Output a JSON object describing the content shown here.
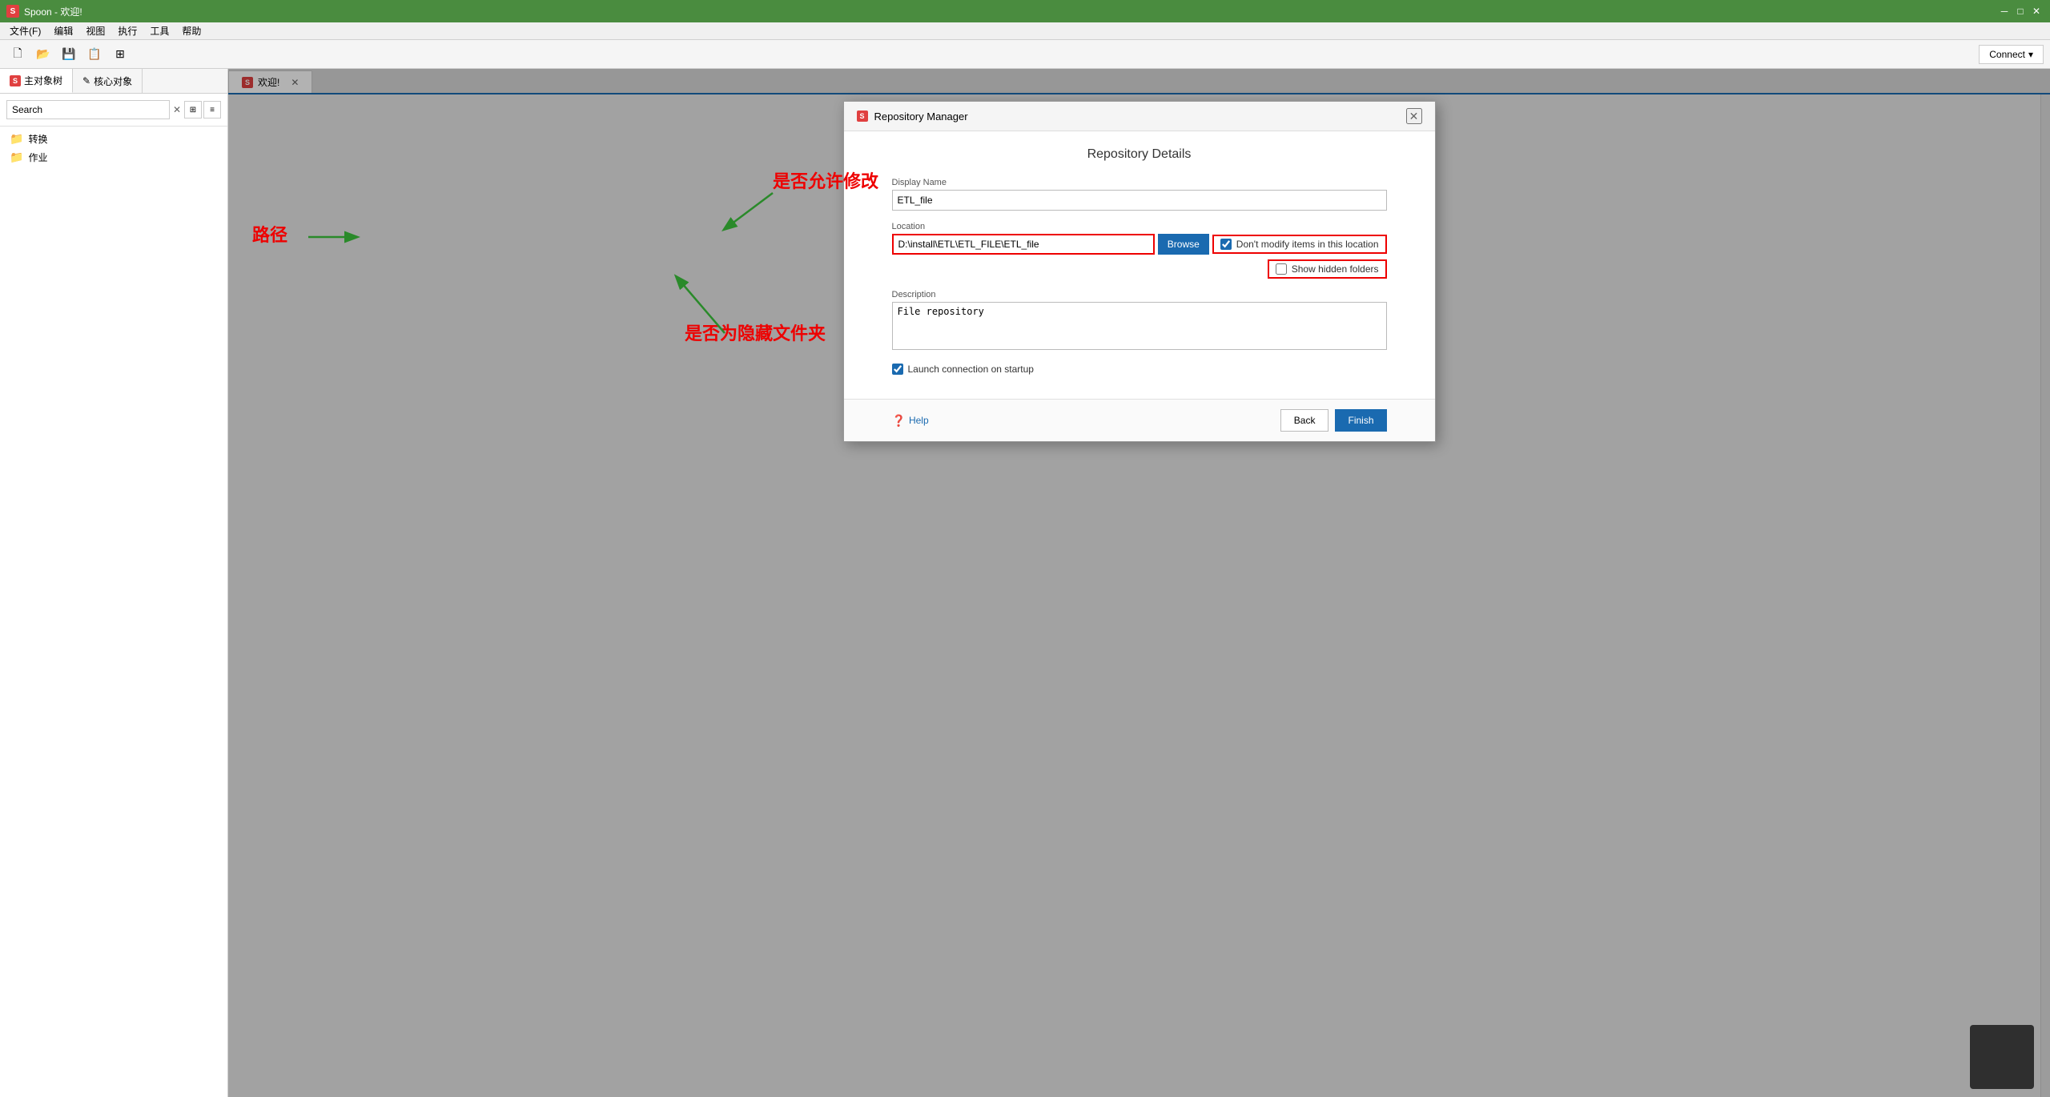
{
  "titleBar": {
    "title": "Spoon - 欢迎!",
    "iconLabel": "S",
    "minimizeBtn": "─",
    "maximizeBtn": "□",
    "closeBtn": "✕"
  },
  "menuBar": {
    "items": [
      "文件(F)",
      "编辑",
      "视图",
      "执行",
      "工具",
      "帮助"
    ]
  },
  "toolbar": {
    "connectBtn": "Connect",
    "connectArrow": "▾"
  },
  "leftPanel": {
    "tabs": [
      {
        "label": "主对象树",
        "iconLabel": "S"
      },
      {
        "label": "核心对象",
        "iconLabel": "✎"
      }
    ],
    "search": {
      "placeholder": "Search",
      "value": "Search"
    },
    "treeItems": [
      {
        "label": "转换"
      },
      {
        "label": "作业"
      }
    ]
  },
  "contentArea": {
    "tabs": [
      {
        "label": "欢迎!",
        "iconLabel": "S",
        "active": true
      }
    ]
  },
  "modal": {
    "titleBar": {
      "iconLabel": "S",
      "title": "Repository Manager",
      "closeBtn": "✕"
    },
    "heading": "Repository Details",
    "form": {
      "displayNameLabel": "Display Name",
      "displayNameValue": "ETL_file",
      "locationLabel": "Location",
      "locationValue": "D:\\install\\ETL\\ETL_FILE\\ETL_file",
      "browseBtnLabel": "Browse",
      "dontModifyLabel": "Don't modify items in this location",
      "dontModifyChecked": true,
      "showHiddenLabel": "Show hidden folders",
      "showHiddenChecked": false,
      "descriptionLabel": "Description",
      "descriptionValue": "File repository",
      "launchOnStartupLabel": "Launch connection on startup",
      "launchOnStartupChecked": true
    },
    "footer": {
      "helpLabel": "Help",
      "backBtn": "Back",
      "finishBtn": "Finish"
    }
  },
  "annotations": {
    "pathLabel": "路径",
    "modifyLabel": "是否允许修改",
    "hiddenLabel": "是否为隐藏文件夹"
  }
}
